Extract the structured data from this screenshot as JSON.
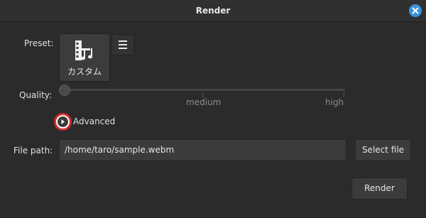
{
  "window": {
    "title": "Render",
    "close_icon": "close-icon",
    "accent_color": "#3a90d8"
  },
  "preset": {
    "label": "Preset:",
    "selected_name": "カスタム",
    "icon": "film-music-icon",
    "menu_icon": "hamburger-menu-icon"
  },
  "quality": {
    "label": "Quality:",
    "tick_labels": [
      "medium",
      "high"
    ],
    "value_fraction": 0.0
  },
  "advanced": {
    "label": "Advanced",
    "expanded": false,
    "highlight_color": "#d42b2b"
  },
  "file": {
    "label": "File path:",
    "value": "/home/taro/sample.webm",
    "select_label": "Select file"
  },
  "actions": {
    "render_label": "Render"
  }
}
